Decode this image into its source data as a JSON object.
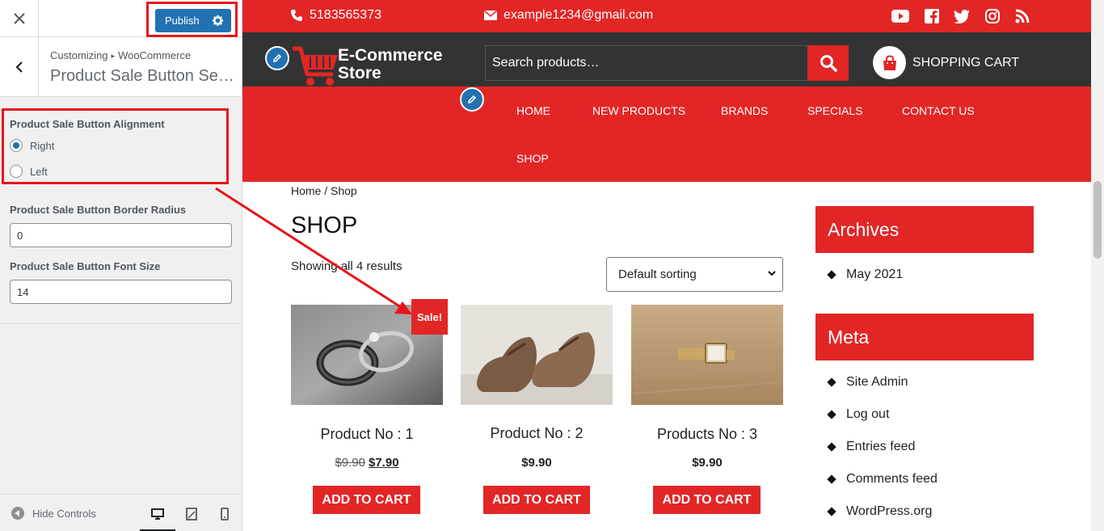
{
  "customizer": {
    "publish_label": "Publish",
    "breadcrumb_root": "Customizing",
    "breadcrumb_section": "WooCommerce",
    "section_title": "Product Sale Button Settings",
    "alignment": {
      "label": "Product Sale Button Alignment",
      "options": [
        "Right",
        "Left"
      ],
      "selected": "Right"
    },
    "border_radius": {
      "label": "Product Sale Button Border Radius",
      "value": "0"
    },
    "font_size": {
      "label": "Product Sale Button Font Size",
      "value": "14"
    },
    "hide_controls_label": "Hide Controls"
  },
  "site": {
    "phone": "5183565373",
    "email": "example1234@gmail.com",
    "logo_line1": "E-Commerce",
    "logo_line2": "Store",
    "search_placeholder": "Search products…",
    "cart_label": "SHOPPING CART",
    "nav": [
      "HOME",
      "NEW PRODUCTS",
      "BRANDS",
      "SPECIALS",
      "CONTACT US",
      "SHOP"
    ]
  },
  "shop": {
    "breadcrumb": "Home / Shop",
    "title": "SHOP",
    "result_count": "Showing all 4 results",
    "sorting": "Default sorting",
    "sale_badge": "Sale!",
    "products": [
      {
        "name": "Product No : 1",
        "old_price": "$9.90",
        "price": "$7.90",
        "button": "ADD TO CART"
      },
      {
        "name": "Product No : 2",
        "old_price": "",
        "price": "$9.90",
        "button": "ADD TO CART"
      },
      {
        "name": "Products No : 3",
        "old_price": "",
        "price": "$9.90",
        "button": "ADD TO CART"
      }
    ]
  },
  "widgets": {
    "archives_title": "Archives",
    "archives": [
      "May 2021"
    ],
    "meta_title": "Meta",
    "meta": [
      "Site Admin",
      "Log out",
      "Entries feed",
      "Comments feed",
      "WordPress.org"
    ]
  },
  "colors": {
    "brand_red": "#e22626",
    "header_dark": "#333333",
    "wp_blue": "#2271b1",
    "annotation_red": "#e8141a"
  }
}
